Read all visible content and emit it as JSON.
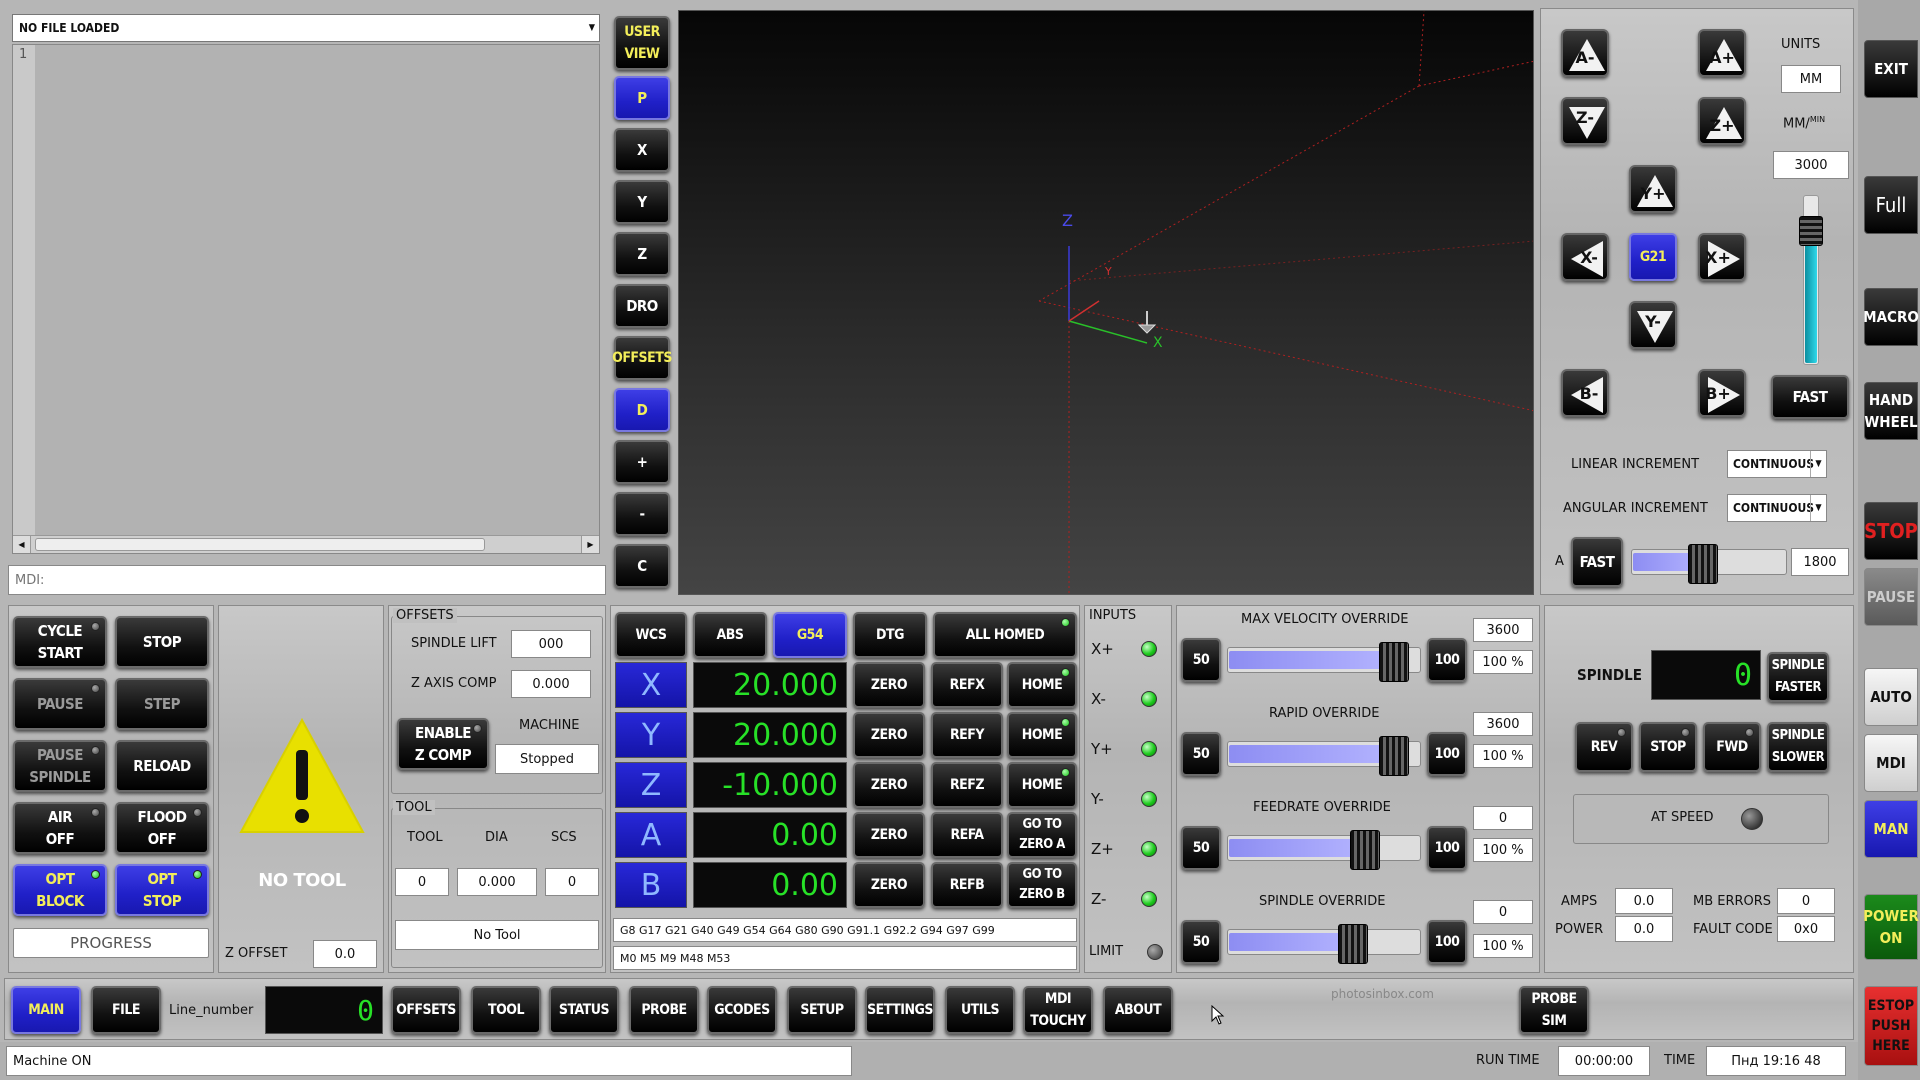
{
  "file": {
    "combo": "NO FILE LOADED",
    "line_no": "1"
  },
  "mdi": {
    "placeholder": "MDI:"
  },
  "view_buttons": [
    "USER\nVIEW",
    "P",
    "X",
    "Y",
    "Z",
    "DRO",
    "OFFSETS",
    "D",
    "+",
    "-",
    "C"
  ],
  "jog": {
    "a_minus": "A-",
    "a_plus": "A+",
    "z_minus": "Z-",
    "z_plus": "Z+",
    "y_plus": "Y+",
    "x_minus": "X-",
    "g21": "G21",
    "x_plus": "X+",
    "y_minus": "Y-",
    "b_minus": "B-",
    "b_plus": "B+",
    "fast": "FAST",
    "units_label": "UNITS",
    "units_value": "MM",
    "rate_label": "MM/",
    "rate_sup": "MIN",
    "rate_value": "3000",
    "linear_label": "LINEAR INCREMENT",
    "linear_value": "CONTINUOUS",
    "angular_label": "ANGULAR INCREMENT",
    "angular_value": "CONTINUOUS",
    "a_label": "A",
    "a_fast": "FAST",
    "a_value": "1800",
    "jog_level": 0.85,
    "a_level": 0.45
  },
  "right_bar": {
    "exit": "EXIT",
    "full": "Full",
    "macro": "MACRO",
    "hand": "HAND\nWHEEL",
    "stop": "STOP",
    "pause": "PAUSE",
    "auto": "AUTO",
    "mdi": "MDI",
    "man": "MAN",
    "power": "POWER\nON",
    "estop": "ESTOP\nPUSH\nHERE"
  },
  "run": {
    "cycle_start": "CYCLE\nSTART",
    "stop": "STOP",
    "pause": "PAUSE",
    "step": "STEP",
    "pause_spindle": "PAUSE\nSPINDLE",
    "reload": "RELOAD",
    "air": "AIR\nOFF",
    "flood": "FLOOD\nOFF",
    "opt_block": "OPT\nBLOCK",
    "opt_stop": "OPT\nSTOP",
    "progress": "PROGRESS"
  },
  "tool_panel": {
    "no_tool": "NO TOOL",
    "z_offset_label": "Z OFFSET",
    "z_offset": "0.0"
  },
  "offsets": {
    "title": "OFFSETS",
    "spindle_lift_label": "SPINDLE LIFT",
    "spindle_lift": "000",
    "z_comp_label": "Z AXIS COMP",
    "z_comp": "0.000",
    "enable": "ENABLE\nZ COMP",
    "machine_label": "MACHINE",
    "machine_state": "Stopped",
    "tool_title": "TOOL",
    "tool_col": "TOOL",
    "dia_col": "DIA",
    "scs_col": "SCS",
    "tool_val": "0",
    "dia_val": "0.000",
    "scs_val": "0",
    "tool_name": "No Tool"
  },
  "dro": {
    "wcs": "WCS",
    "abs": "ABS",
    "g54": "G54",
    "dtg": "DTG",
    "homed": "ALL HOMED",
    "zero": "ZERO",
    "axes": [
      {
        "name": "X",
        "value": "20.000",
        "ref": "REFX",
        "home": "HOME"
      },
      {
        "name": "Y",
        "value": "20.000",
        "ref": "REFY",
        "home": "HOME"
      },
      {
        "name": "Z",
        "value": "-10.000",
        "ref": "REFZ",
        "home": "HOME"
      },
      {
        "name": "A",
        "value": "0.00",
        "ref": "REFA",
        "home": "GO TO\nZERO  A"
      },
      {
        "name": "B",
        "value": "0.00",
        "ref": "REFB",
        "home": "GO TO\nZERO B"
      }
    ],
    "gcodes": "G8 G17 G21 G40 G49 G54 G64 G80 G90 G91.1 G92.2 G94 G97 G99",
    "mcodes": "M0 M5 M9 M48 M53"
  },
  "inputs": {
    "title": "INPUTS",
    "items": [
      "X+",
      "X-",
      "Y+",
      "Y-",
      "Z+",
      "Z-"
    ],
    "limit": "LIMIT"
  },
  "overrides": [
    {
      "title": "MAX VELOCITY OVERRIDE",
      "low": "50",
      "high": "100",
      "value": "3600",
      "pct": "100 %",
      "level": 0.93
    },
    {
      "title": "RAPID OVERRIDE",
      "low": "50",
      "high": "100",
      "value": "3600",
      "pct": "100 %",
      "level": 0.93
    },
    {
      "title": "FEEDRATE OVERRIDE",
      "low": "50",
      "high": "100",
      "value": "0",
      "pct": "100 %",
      "level": 0.75
    },
    {
      "title": "SPINDLE OVERRIDE",
      "low": "50",
      "high": "100",
      "value": "0",
      "pct": "100 %",
      "level": 0.68
    }
  ],
  "spindle": {
    "label": "SPINDLE",
    "rpm": "0",
    "faster": "SPINDLE\nFASTER",
    "slower": "SPINDLE\nSLOWER",
    "rev": "REV",
    "stop": "STOP",
    "fwd": "FWD",
    "at_speed": "AT SPEED",
    "amps_label": "AMPS",
    "amps": "0.0",
    "power_label": "POWER",
    "power": "0.0",
    "mb_label": "MB ERRORS",
    "mb": "0",
    "fault_label": "FAULT CODE",
    "fault": "0x0"
  },
  "bottom": {
    "main": "MAIN",
    "file": "FILE",
    "line_label": "Line_number",
    "line_value": "0",
    "tabs": [
      "OFFSETS",
      "TOOL",
      "STATUS",
      "PROBE",
      "GCODES",
      "SETUP",
      "SETTINGS",
      "UTILS",
      "MDI\nTOUCHY",
      "ABOUT"
    ],
    "probe_sim": "PROBE\nSIM",
    "watermark": "photosinbox.com"
  },
  "status": {
    "message": "Machine ON",
    "run_time_label": "RUN TIME",
    "run_time": "00:00:00",
    "time_label": "TIME",
    "time": "Пнд 19:16 48"
  },
  "viewport": {
    "axis_z": "Z",
    "axis_y": "Y",
    "axis_x": "X"
  }
}
